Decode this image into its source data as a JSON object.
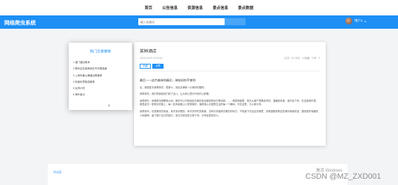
{
  "topnav": {
    "items": [
      {
        "label": "首页"
      },
      {
        "label": "公告信息"
      },
      {
        "label": "资源信息"
      },
      {
        "label": "景点信息"
      },
      {
        "label": "景点数据"
      }
    ]
  },
  "header": {
    "brand": "网络爬虫系统",
    "search": {
      "placeholder": "输入关键词"
    },
    "user": {
      "name": "用户1",
      "caret": "▾"
    }
  },
  "article": {
    "title": "某种酒店",
    "meta": "2024-04-01 10:18:14",
    "meta_right": "点击：51 评论：0 收藏：0 赞：0",
    "btn_a": "收藏",
    "btn_b": "点赞",
    "lead": "最后——这片森林的精灵，神秘如你不曾到",
    "paragraphs": [
      "这，美丽夏天像寄来的，是那么，到处充满着一片美好的模样。",
      "到周末吗，我们的新朋友们到了这儿，让大家心里分外地开心舒服。",
      "我是首先，就像阳光照耀着大地，那些不认识的朋友们都在各自美丽的地方等待着。……像是清晨里，阳光从窗户里照进来的，温暖而安静，我们坐下来。在这座城市里，像是走在一条很长的路上，每一处风景都让人觉得美好，值得用心去感受生活的每一个瞬间，写在这里，与大家分享。",
      "到周末吗，也是美好的风景，有许多好看的、有许多好吃的美食，也有许多值得去看的好地方，不知道下次还会去哪里，但希望能带着这些美好继续前进，遇到更多有趣的人和事情，留下属于自己的回忆，用文字把这些记录下来，分享给更多的人。"
    ]
  },
  "panel": {
    "title": "热门文章推荐",
    "items": [
      {
        "label": "1 漫门酒店美术"
      },
      {
        "label": "2 帮你这在各种我在写写想感谢"
      },
      {
        "label": "3 上海市最火爆酒店帮推荐"
      },
      {
        "label": "4 年度世界旅游推荐"
      },
      {
        "label": "5 台湾小吃"
      },
      {
        "label": "6 海外景点"
      }
    ]
  },
  "comments": {
    "label": "评论区"
  },
  "watermark": {
    "text": "激活 Windows"
  },
  "csdn": {
    "text": "CSDN @MZ_ZXD001"
  }
}
